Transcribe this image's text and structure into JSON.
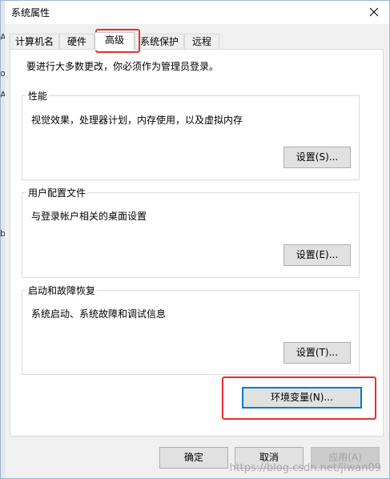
{
  "window": {
    "title": "系统属性"
  },
  "left_fragments": [
    "A",
    "o",
    "A",
    "b"
  ],
  "tabs": [
    {
      "label": "计算机名"
    },
    {
      "label": "硬件"
    },
    {
      "label": "高级",
      "active": true
    },
    {
      "label": "系统保护"
    },
    {
      "label": "远程"
    }
  ],
  "panel": {
    "intro": "要进行大多数更改，你必须作为管理员登录。",
    "performance": {
      "title": "性能",
      "desc": "视觉效果，处理器计划，内存使用，以及虚拟内存",
      "button": "设置(S)..."
    },
    "user_profiles": {
      "title": "用户配置文件",
      "desc": "与登录帐户相关的桌面设置",
      "button": "设置(E)..."
    },
    "startup_recovery": {
      "title": "启动和故障恢复",
      "desc": "系统启动、系统故障和调试信息",
      "button": "设置(T)..."
    },
    "env_button": "环境变量(N)..."
  },
  "footer": {
    "ok": "确定",
    "cancel": "取消",
    "apply": "应用(A)"
  },
  "watermark": "https://blog.csdn.net/jiwan09",
  "colors": {
    "annotation": "#e53030",
    "focus": "#0078d7",
    "button_face": "#e1e1e1"
  }
}
